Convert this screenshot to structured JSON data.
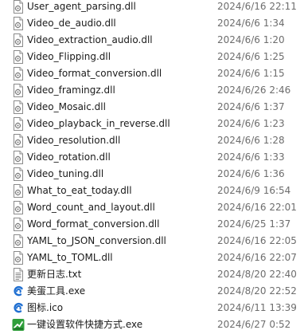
{
  "files": [
    {
      "name": "User_agent_parsing.dll",
      "date": "2024/6/16 22:11",
      "icon": "dll-file-icon"
    },
    {
      "name": "Video_de_audio.dll",
      "date": "2024/6/6 1:34",
      "icon": "dll-file-icon"
    },
    {
      "name": "Video_extraction_audio.dll",
      "date": "2024/6/6 1:20",
      "icon": "dll-file-icon"
    },
    {
      "name": "Video_Flipping.dll",
      "date": "2024/6/6 1:25",
      "icon": "dll-file-icon"
    },
    {
      "name": "Video_format_conversion.dll",
      "date": "2024/6/6 1:15",
      "icon": "dll-file-icon"
    },
    {
      "name": "Video_framingz.dll",
      "date": "2024/6/26 2:46",
      "icon": "dll-file-icon"
    },
    {
      "name": "Video_Mosaic.dll",
      "date": "2024/6/6 1:37",
      "icon": "dll-file-icon"
    },
    {
      "name": "Video_playback_in_reverse.dll",
      "date": "2024/6/6 1:23",
      "icon": "dll-file-icon"
    },
    {
      "name": "Video_resolution.dll",
      "date": "2024/6/6 1:28",
      "icon": "dll-file-icon"
    },
    {
      "name": "Video_rotation.dll",
      "date": "2024/6/6 1:33",
      "icon": "dll-file-icon"
    },
    {
      "name": "Video_tuning.dll",
      "date": "2024/6/6 1:36",
      "icon": "dll-file-icon"
    },
    {
      "name": "What_to_eat_today.dll",
      "date": "2024/6/9 16:54",
      "icon": "dll-file-icon"
    },
    {
      "name": "Word_count_and_layout.dll",
      "date": "2024/6/16 22:01",
      "icon": "dll-file-icon"
    },
    {
      "name": "Word_format_conversion.dll",
      "date": "2024/6/25 1:37",
      "icon": "dll-file-icon"
    },
    {
      "name": "YAML_to_JSON_conversion.dll",
      "date": "2024/6/16 22:05",
      "icon": "dll-file-icon"
    },
    {
      "name": "YAML_to_TOML.dll",
      "date": "2024/6/16 22:07",
      "icon": "dll-file-icon"
    },
    {
      "name": "更新日志.txt",
      "date": "2024/8/20 22:40",
      "icon": "text-file-icon"
    },
    {
      "name": "美蛋工具.exe",
      "date": "2024/8/20 22:52",
      "icon": "app-swirl-icon"
    },
    {
      "name": "图标.ico",
      "date": "2024/6/11 13:39",
      "icon": "app-swirl-icon"
    },
    {
      "name": "一键设置软件快捷方式.exe",
      "date": "2024/6/27 0:52",
      "icon": "green-app-icon"
    }
  ],
  "colors": {
    "name_text": "#1a1a1a",
    "date_text": "#6d6d6d",
    "swirl_blue": "#1f6fd1",
    "green_app": "#2e9e3a"
  }
}
